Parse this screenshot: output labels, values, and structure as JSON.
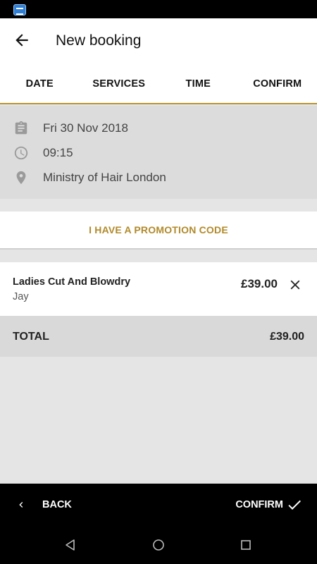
{
  "header": {
    "title": "New booking"
  },
  "tabs": [
    {
      "label": "DATE"
    },
    {
      "label": "SERVICES"
    },
    {
      "label": "TIME"
    },
    {
      "label": "CONFIRM"
    }
  ],
  "summary": {
    "date": "Fri 30 Nov 2018",
    "time": "09:15",
    "location": "Ministry of Hair London"
  },
  "promo": {
    "label": "I HAVE A PROMOTION CODE"
  },
  "service": {
    "name": "Ladies Cut And Blowdry",
    "staff": "Jay",
    "price": "£39.00"
  },
  "total": {
    "label": "TOTAL",
    "value": "£39.00"
  },
  "footer": {
    "back_label": "BACK",
    "confirm_label": "CONFIRM"
  },
  "colors": {
    "accent": "#b18a2a",
    "tab_underline": "#b8952f",
    "bar_bg": "#000000"
  },
  "icons": [
    "back-arrow-icon",
    "clipboard-icon",
    "clock-icon",
    "location-pin-icon",
    "close-icon",
    "chevron-left-icon",
    "checkmark-icon"
  ]
}
